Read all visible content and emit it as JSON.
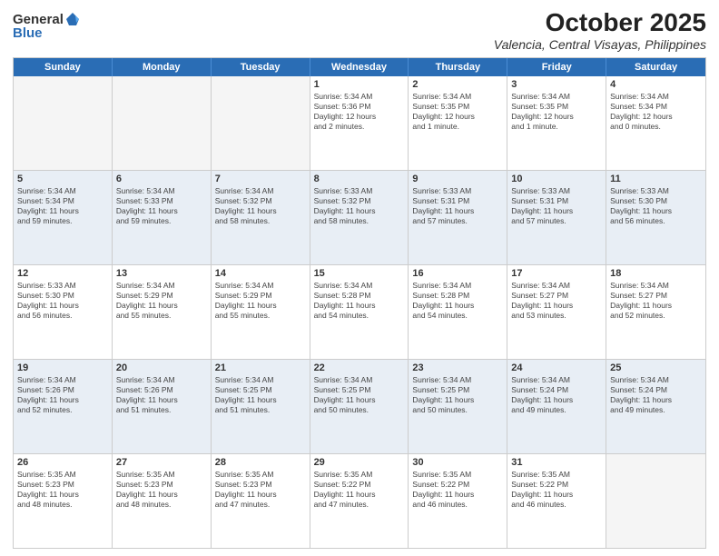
{
  "header": {
    "logo": {
      "general": "General",
      "blue": "Blue"
    },
    "title": "October 2025",
    "location": "Valencia, Central Visayas, Philippines"
  },
  "day_headers": [
    "Sunday",
    "Monday",
    "Tuesday",
    "Wednesday",
    "Thursday",
    "Friday",
    "Saturday"
  ],
  "weeks": [
    {
      "alt": false,
      "days": [
        {
          "num": "",
          "info": "",
          "empty": true
        },
        {
          "num": "",
          "info": "",
          "empty": true
        },
        {
          "num": "",
          "info": "",
          "empty": true
        },
        {
          "num": "1",
          "info": "Sunrise: 5:34 AM\nSunset: 5:36 PM\nDaylight: 12 hours\nand 2 minutes.",
          "empty": false
        },
        {
          "num": "2",
          "info": "Sunrise: 5:34 AM\nSunset: 5:35 PM\nDaylight: 12 hours\nand 1 minute.",
          "empty": false
        },
        {
          "num": "3",
          "info": "Sunrise: 5:34 AM\nSunset: 5:35 PM\nDaylight: 12 hours\nand 1 minute.",
          "empty": false
        },
        {
          "num": "4",
          "info": "Sunrise: 5:34 AM\nSunset: 5:34 PM\nDaylight: 12 hours\nand 0 minutes.",
          "empty": false
        }
      ]
    },
    {
      "alt": true,
      "days": [
        {
          "num": "5",
          "info": "Sunrise: 5:34 AM\nSunset: 5:34 PM\nDaylight: 11 hours\nand 59 minutes.",
          "empty": false
        },
        {
          "num": "6",
          "info": "Sunrise: 5:34 AM\nSunset: 5:33 PM\nDaylight: 11 hours\nand 59 minutes.",
          "empty": false
        },
        {
          "num": "7",
          "info": "Sunrise: 5:34 AM\nSunset: 5:32 PM\nDaylight: 11 hours\nand 58 minutes.",
          "empty": false
        },
        {
          "num": "8",
          "info": "Sunrise: 5:33 AM\nSunset: 5:32 PM\nDaylight: 11 hours\nand 58 minutes.",
          "empty": false
        },
        {
          "num": "9",
          "info": "Sunrise: 5:33 AM\nSunset: 5:31 PM\nDaylight: 11 hours\nand 57 minutes.",
          "empty": false
        },
        {
          "num": "10",
          "info": "Sunrise: 5:33 AM\nSunset: 5:31 PM\nDaylight: 11 hours\nand 57 minutes.",
          "empty": false
        },
        {
          "num": "11",
          "info": "Sunrise: 5:33 AM\nSunset: 5:30 PM\nDaylight: 11 hours\nand 56 minutes.",
          "empty": false
        }
      ]
    },
    {
      "alt": false,
      "days": [
        {
          "num": "12",
          "info": "Sunrise: 5:33 AM\nSunset: 5:30 PM\nDaylight: 11 hours\nand 56 minutes.",
          "empty": false
        },
        {
          "num": "13",
          "info": "Sunrise: 5:34 AM\nSunset: 5:29 PM\nDaylight: 11 hours\nand 55 minutes.",
          "empty": false
        },
        {
          "num": "14",
          "info": "Sunrise: 5:34 AM\nSunset: 5:29 PM\nDaylight: 11 hours\nand 55 minutes.",
          "empty": false
        },
        {
          "num": "15",
          "info": "Sunrise: 5:34 AM\nSunset: 5:28 PM\nDaylight: 11 hours\nand 54 minutes.",
          "empty": false
        },
        {
          "num": "16",
          "info": "Sunrise: 5:34 AM\nSunset: 5:28 PM\nDaylight: 11 hours\nand 54 minutes.",
          "empty": false
        },
        {
          "num": "17",
          "info": "Sunrise: 5:34 AM\nSunset: 5:27 PM\nDaylight: 11 hours\nand 53 minutes.",
          "empty": false
        },
        {
          "num": "18",
          "info": "Sunrise: 5:34 AM\nSunset: 5:27 PM\nDaylight: 11 hours\nand 52 minutes.",
          "empty": false
        }
      ]
    },
    {
      "alt": true,
      "days": [
        {
          "num": "19",
          "info": "Sunrise: 5:34 AM\nSunset: 5:26 PM\nDaylight: 11 hours\nand 52 minutes.",
          "empty": false
        },
        {
          "num": "20",
          "info": "Sunrise: 5:34 AM\nSunset: 5:26 PM\nDaylight: 11 hours\nand 51 minutes.",
          "empty": false
        },
        {
          "num": "21",
          "info": "Sunrise: 5:34 AM\nSunset: 5:25 PM\nDaylight: 11 hours\nand 51 minutes.",
          "empty": false
        },
        {
          "num": "22",
          "info": "Sunrise: 5:34 AM\nSunset: 5:25 PM\nDaylight: 11 hours\nand 50 minutes.",
          "empty": false
        },
        {
          "num": "23",
          "info": "Sunrise: 5:34 AM\nSunset: 5:25 PM\nDaylight: 11 hours\nand 50 minutes.",
          "empty": false
        },
        {
          "num": "24",
          "info": "Sunrise: 5:34 AM\nSunset: 5:24 PM\nDaylight: 11 hours\nand 49 minutes.",
          "empty": false
        },
        {
          "num": "25",
          "info": "Sunrise: 5:34 AM\nSunset: 5:24 PM\nDaylight: 11 hours\nand 49 minutes.",
          "empty": false
        }
      ]
    },
    {
      "alt": false,
      "days": [
        {
          "num": "26",
          "info": "Sunrise: 5:35 AM\nSunset: 5:23 PM\nDaylight: 11 hours\nand 48 minutes.",
          "empty": false
        },
        {
          "num": "27",
          "info": "Sunrise: 5:35 AM\nSunset: 5:23 PM\nDaylight: 11 hours\nand 48 minutes.",
          "empty": false
        },
        {
          "num": "28",
          "info": "Sunrise: 5:35 AM\nSunset: 5:23 PM\nDaylight: 11 hours\nand 47 minutes.",
          "empty": false
        },
        {
          "num": "29",
          "info": "Sunrise: 5:35 AM\nSunset: 5:22 PM\nDaylight: 11 hours\nand 47 minutes.",
          "empty": false
        },
        {
          "num": "30",
          "info": "Sunrise: 5:35 AM\nSunset: 5:22 PM\nDaylight: 11 hours\nand 46 minutes.",
          "empty": false
        },
        {
          "num": "31",
          "info": "Sunrise: 5:35 AM\nSunset: 5:22 PM\nDaylight: 11 hours\nand 46 minutes.",
          "empty": false
        },
        {
          "num": "",
          "info": "",
          "empty": true
        }
      ]
    }
  ]
}
